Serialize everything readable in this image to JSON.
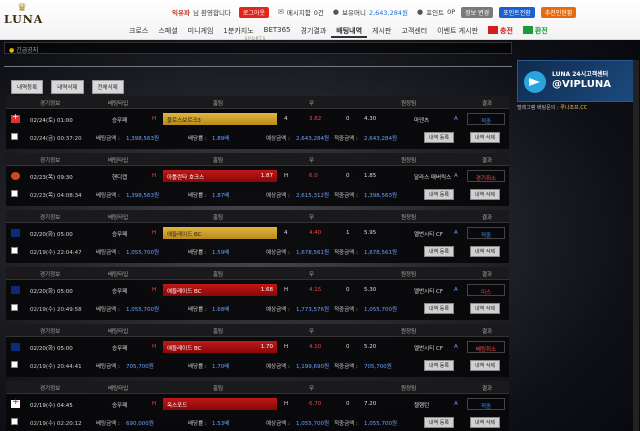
{
  "logo": {
    "crown": "♛",
    "name": "LUNA",
    "sub": "SPORTS"
  },
  "user": {
    "name": "익유파",
    "greeting": "님 환영합니다",
    "logout": "로그아웃",
    "message_label": "메시지함",
    "message_count": "0건",
    "balance_label": "보유머니",
    "balance": "2,643,284원",
    "point_label": "포인트",
    "point": "0P",
    "btn_change": "정보 변경",
    "btn_point": "포인트전환",
    "btn_recommend": "추천인현황"
  },
  "nav": {
    "items": [
      "크로스",
      "스페셜",
      "미니게임",
      "1분카지노",
      "BET365",
      "경기결과",
      "배팅내역",
      "게시판",
      "고객센터",
      "이벤트 게시판"
    ],
    "charge": "충전",
    "exchange": "환전"
  },
  "notice": {
    "label": "긴급공지"
  },
  "filters": [
    "내역등록",
    "내역삭제",
    "전체삭제"
  ],
  "telegram": {
    "line1": "LUNA 24시고객센터",
    "line2": "@VIPLUNA"
  },
  "history": {
    "label": "텔레그램 배팅문의 :",
    "value": "루나조프.CC"
  },
  "labels": {
    "h_info": "경기정보",
    "h_type": "베팅타입",
    "h_home": "홈팀",
    "h_draw": "무",
    "h_away": "원정팀",
    "h_result": "결과",
    "bet_amount": "베팅금액 :",
    "odds": "배당률 :",
    "expect": "예상금액 :",
    "win_amount": "적중금액 :",
    "btn_register": "내역 등록",
    "btn_delete": "내역 삭제"
  },
  "bets": [
    {
      "flag": "cr",
      "date": "02/24(토) 01:00",
      "type": "승무패",
      "home": "블로스보르크3",
      "home_odd": "",
      "team_style": "gold",
      "h": "4",
      "draw": "3.82",
      "score": "0",
      "away_odd": "4.30",
      "away": "마덴츠",
      "a": "A",
      "result": "적중",
      "res_style": "win",
      "sub_date": "02/24(금) 00:37:20",
      "amount": "1,398,563원",
      "odds": "1.89배",
      "expect": "2,643,284원",
      "win": "2,643,284원"
    },
    {
      "flag": "ball",
      "date": "02/23(목) 09:30",
      "type": "핸디캡",
      "home": "아틀란타 호크스",
      "home_odd": "1.87",
      "team_style": "red",
      "h": "H",
      "draw": "6.0",
      "score": "0",
      "away_odd": "1.85",
      "away": "달라스 매버릭스",
      "a": "A",
      "result": "경기취소",
      "res_style": "cancel",
      "sub_date": "02/23(목) 04:08:34",
      "amount": "1,398,563원",
      "odds": "1.87배",
      "expect": "2,615,312원",
      "win": "1,398,563원"
    },
    {
      "flag": "au",
      "date": "02/20(화) 05:00",
      "type": "승무패",
      "home": "애들레이드 BC",
      "home_odd": "",
      "team_style": "gold",
      "h": "4",
      "draw": "4.40",
      "score": "1",
      "away_odd": "5.95",
      "away": "멜번시티 CF",
      "a": "A",
      "result": "적중",
      "res_style": "win",
      "sub_date": "02/19(수) 22:04:47",
      "amount": "1,055,700원",
      "odds": "1.59배",
      "expect": "1,678,561원",
      "win": "1,678,561원"
    },
    {
      "flag": "au",
      "date": "02/20(화) 05:00",
      "type": "승무패",
      "home": "애들레이드 BC",
      "home_odd": "1.68",
      "team_style": "red",
      "h": "H",
      "draw": "4.15",
      "score": "0",
      "away_odd": "5.30",
      "away": "멜번시티 CF",
      "a": "A",
      "result": "미스",
      "res_style": "lose",
      "sub_date": "02/19(수) 20:49:58",
      "amount": "1,055,700원",
      "odds": "1.68배",
      "expect": "1,773,576원",
      "win": "1,055,700원"
    },
    {
      "flag": "au",
      "date": "02/20(화) 05:00",
      "type": "승무패",
      "home": "애들레이드 BC",
      "home_odd": "1.70",
      "team_style": "red",
      "h": "H",
      "draw": "4.10",
      "score": "0",
      "away_odd": "5.20",
      "away": "멜번시티 CF",
      "a": "A",
      "result": "베팅취소",
      "res_style": "cancel",
      "sub_date": "02/19(수) 20:44:41",
      "amount": "705,700원",
      "odds": "1.70배",
      "expect": "1,199,690원",
      "win": "705,700원"
    },
    {
      "flag": "en",
      "date": "02/19(수) 04:45",
      "type": "승무패",
      "home": "옥스포드",
      "home_odd": "",
      "team_style": "red",
      "h": "H",
      "draw": "6.70",
      "score": "0",
      "away_odd": "7.20",
      "away": "첼햄턴",
      "a": "A",
      "result": "적중",
      "res_style": "win",
      "sub_date": "02/19(수) 02:20:12",
      "amount": "690,000원",
      "odds": "1.53배",
      "expect": "1,055,700원",
      "win": "1,055,700원"
    }
  ]
}
